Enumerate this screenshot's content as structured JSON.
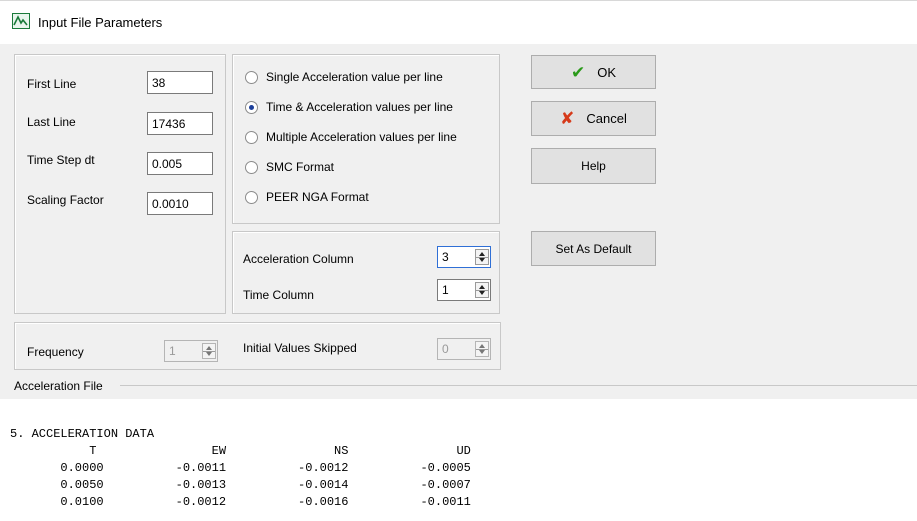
{
  "window": {
    "title": "Input File Parameters"
  },
  "line_range": {
    "first_line_label": "First Line",
    "first_line_value": "38",
    "last_line_label": "Last Line",
    "last_line_value": "17436",
    "time_step_label": "Time Step dt",
    "time_step_value": "0.005",
    "scaling_label": "Scaling Factor",
    "scaling_value": "0.0010"
  },
  "format_options": [
    {
      "label": "Single Acceleration value per line",
      "selected": false
    },
    {
      "label": "Time & Acceleration values per line",
      "selected": true
    },
    {
      "label": "Multiple Acceleration values per line",
      "selected": false
    },
    {
      "label": "SMC Format",
      "selected": false
    },
    {
      "label": "PEER NGA Format",
      "selected": false
    }
  ],
  "columns": {
    "acceleration_label": "Acceleration Column",
    "acceleration_value": "3",
    "time_label": "Time Column",
    "time_value": "1"
  },
  "sampling": {
    "frequency_label": "Frequency",
    "frequency_value": "1",
    "skipped_label": "Initial Values Skipped",
    "skipped_value": "0"
  },
  "buttons": {
    "ok": "OK",
    "cancel": "Cancel",
    "help": "Help",
    "set_default": "Set As Default"
  },
  "acceleration_file": {
    "label": "Acceleration File",
    "lines": [
      "5. ACCELERATION DATA",
      "           T                EW               NS               UD",
      "       0.0000          -0.0011          -0.0012          -0.0005",
      "       0.0050          -0.0013          -0.0014          -0.0007",
      "       0.0100          -0.0012          -0.0016          -0.0011"
    ]
  },
  "colors": {
    "dialog_bg": "#f0f0f0",
    "ok_check": "#2a9a1a",
    "cancel_cross": "#d63a1a",
    "radio_selected": "#1c3f9a",
    "focus_border": "#2f6fd6"
  }
}
